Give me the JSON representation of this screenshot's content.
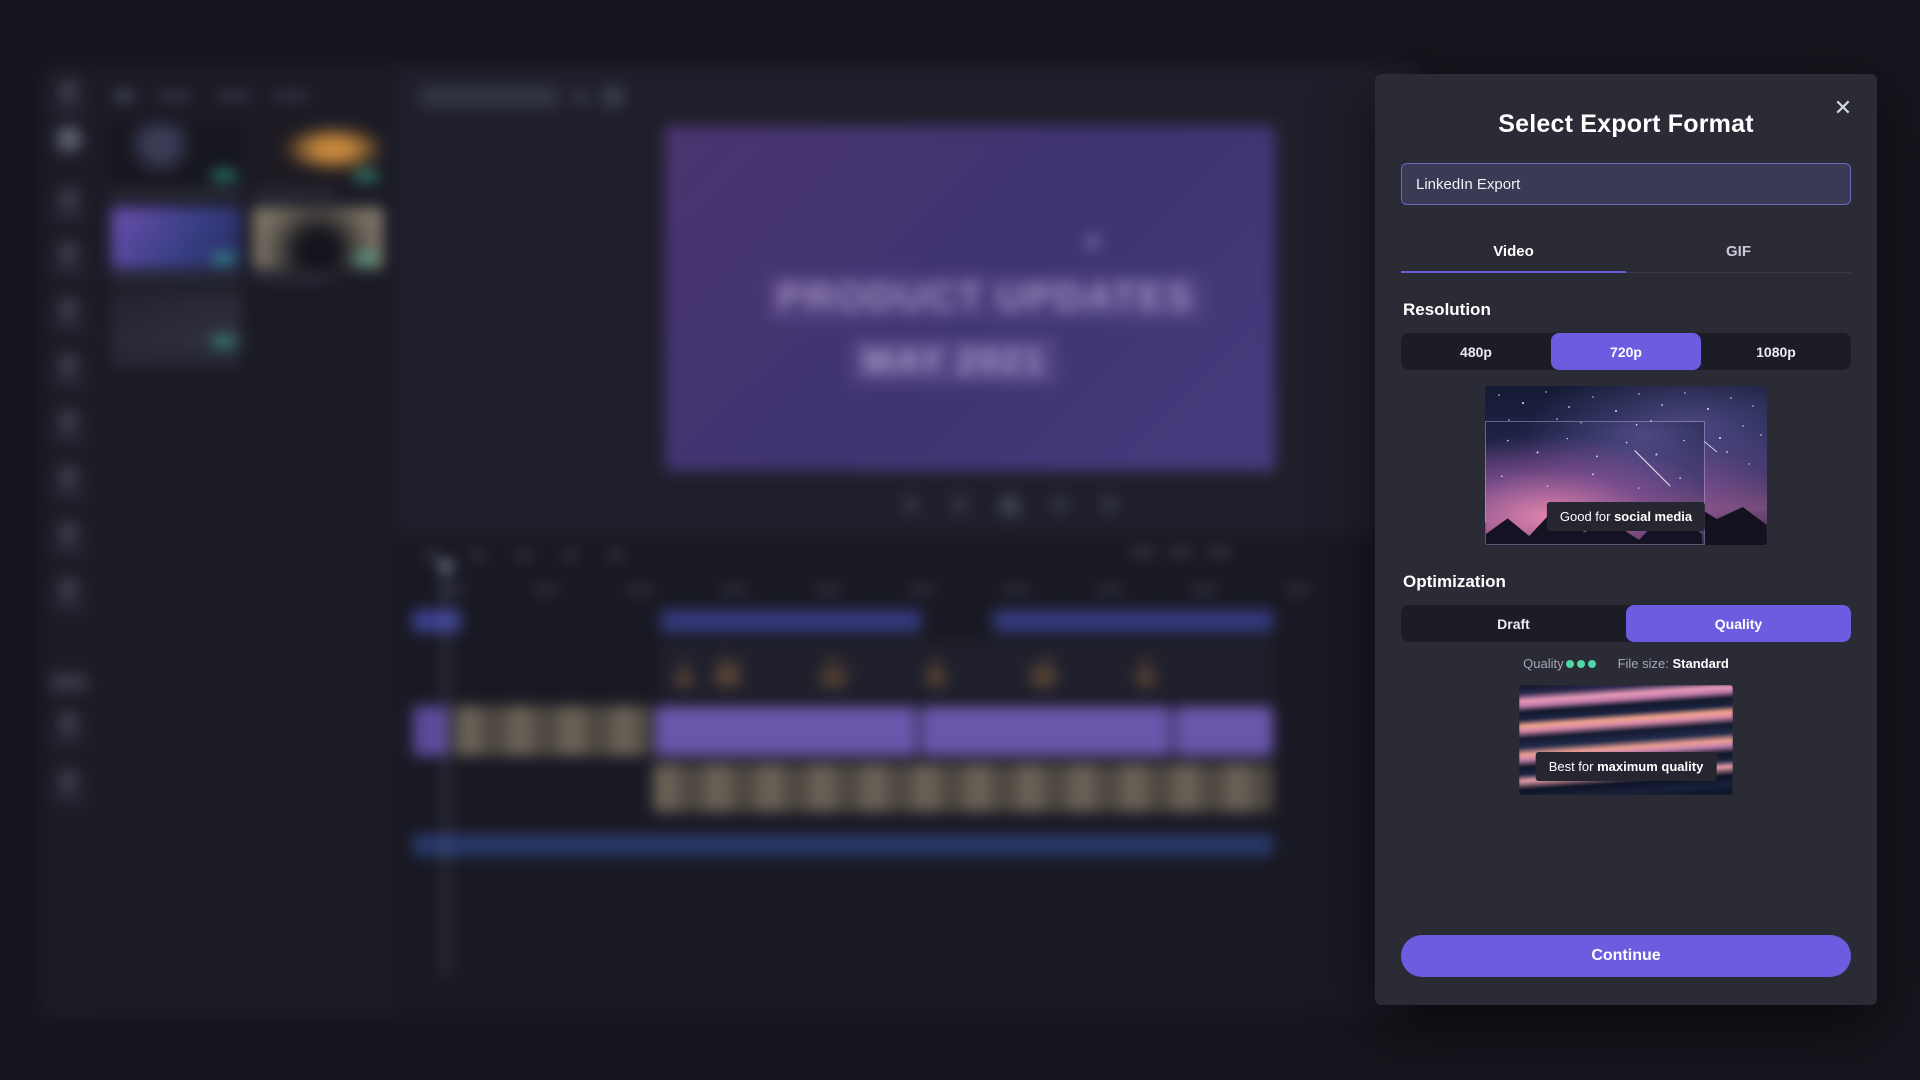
{
  "modal": {
    "title": "Select Export Format",
    "close_icon": "close-icon",
    "name_field": {
      "value": "LinkedIn Export",
      "placeholder": "Export name"
    },
    "tabs": [
      {
        "label": "Video",
        "active": true
      },
      {
        "label": "GIF",
        "active": false
      }
    ],
    "resolution": {
      "title": "Resolution",
      "options": [
        {
          "label": "480p",
          "selected": false
        },
        {
          "label": "720p",
          "selected": true
        },
        {
          "label": "1080p",
          "selected": false
        }
      ],
      "preview": {
        "image": "starry-night-sky-over-mountains",
        "caption_prefix": "Good for ",
        "caption_emphasis": "social media"
      }
    },
    "optimization": {
      "title": "Optimization",
      "options": [
        {
          "label": "Draft",
          "selected": false
        },
        {
          "label": "Quality",
          "selected": true
        }
      ],
      "quality_label": "Quality",
      "quality_dots": 3,
      "file_size_label": "File size:",
      "file_size_value": "Standard",
      "preview": {
        "image": "abstract-wavy-sunset-water",
        "caption_prefix": "Best for ",
        "caption_emphasis": "maximum quality"
      }
    },
    "continue_label": "Continue"
  },
  "background": {
    "canvas": {
      "title": "PRODUCT UPDATES",
      "subtitle": "MAY 2021"
    }
  },
  "colors": {
    "accent": "#6c5ce0",
    "modal_bg": "#2b2b36",
    "input_bg": "#393a54",
    "segment_bg": "#1c1c26",
    "quality_dot": "#4fd6a8",
    "app_bg": "#15151d"
  }
}
